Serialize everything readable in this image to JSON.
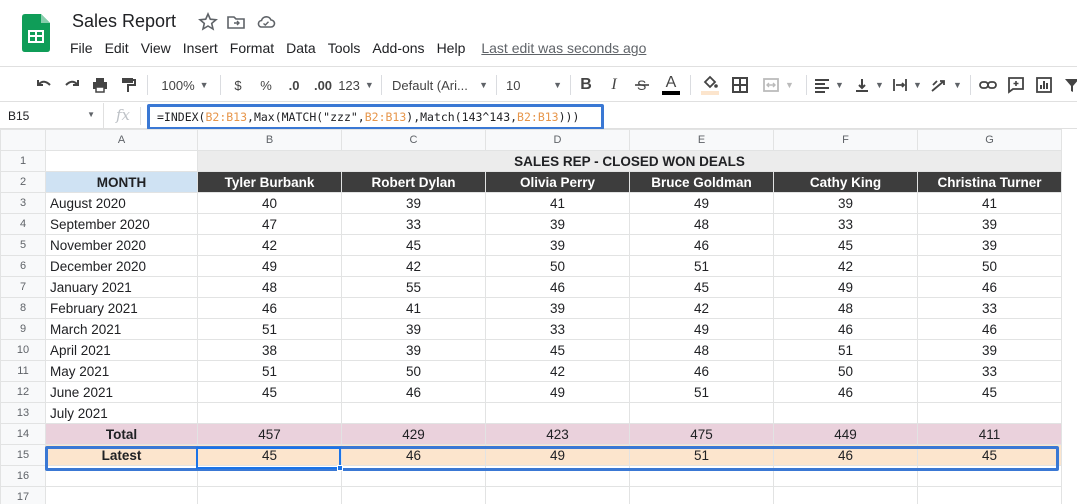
{
  "app": {
    "title": "Sales Report",
    "menu": [
      "File",
      "Edit",
      "View",
      "Insert",
      "Format",
      "Data",
      "Tools",
      "Add-ons",
      "Help"
    ],
    "last_edit": "Last edit was seconds ago"
  },
  "toolbar": {
    "zoom": "100%",
    "currency": "$",
    "percent": "%",
    "decrease_decimals": ".0",
    "increase_decimals": ".00",
    "more_formats": "123",
    "font": "Default (Ari...",
    "font_size": "10",
    "bold": "B",
    "italic": "I",
    "text_color": "A"
  },
  "formula_bar": {
    "name_box": "B15",
    "fx": "fx",
    "formula_parts": [
      {
        "text": "=INDEX(",
        "ref": false
      },
      {
        "text": "B2:B13",
        "ref": true
      },
      {
        "text": ",Max(MATCH(\"zzz\",",
        "ref": false
      },
      {
        "text": "B2:B13",
        "ref": true
      },
      {
        "text": "),Match(143^143,",
        "ref": false
      },
      {
        "text": "B2:B13",
        "ref": true
      },
      {
        "text": ")))",
        "ref": false
      }
    ]
  },
  "sheet": {
    "columns": [
      "A",
      "B",
      "C",
      "D",
      "E",
      "F",
      "G"
    ],
    "row_numbers": [
      "1",
      "2",
      "3",
      "4",
      "5",
      "6",
      "7",
      "8",
      "9",
      "10",
      "11",
      "12",
      "13",
      "14",
      "15",
      "16",
      "17"
    ],
    "banner": "SALES REP - CLOSED WON DEALS",
    "month_header": "MONTH",
    "reps": [
      "Tyler Burbank",
      "Robert Dylan",
      "Olivia Perry",
      "Bruce Goldman",
      "Cathy King",
      "Christina Turner"
    ],
    "rows": [
      {
        "month": "August 2020",
        "values": [
          "40",
          "39",
          "41",
          "49",
          "39",
          "41"
        ]
      },
      {
        "month": "September 2020",
        "values": [
          "47",
          "33",
          "39",
          "48",
          "33",
          "39"
        ]
      },
      {
        "month": "November 2020",
        "values": [
          "42",
          "45",
          "39",
          "46",
          "45",
          "39"
        ]
      },
      {
        "month": "December 2020",
        "values": [
          "49",
          "42",
          "50",
          "51",
          "42",
          "50"
        ]
      },
      {
        "month": "January 2021",
        "values": [
          "48",
          "55",
          "46",
          "45",
          "49",
          "46"
        ]
      },
      {
        "month": "February 2021",
        "values": [
          "46",
          "41",
          "39",
          "42",
          "48",
          "33"
        ]
      },
      {
        "month": "March 2021",
        "values": [
          "51",
          "39",
          "33",
          "49",
          "46",
          "46"
        ]
      },
      {
        "month": "April 2021",
        "values": [
          "38",
          "39",
          "45",
          "48",
          "51",
          "39"
        ]
      },
      {
        "month": "May 2021",
        "values": [
          "51",
          "50",
          "42",
          "46",
          "50",
          "33"
        ]
      },
      {
        "month": "June 2021",
        "values": [
          "45",
          "46",
          "49",
          "51",
          "46",
          "45"
        ]
      },
      {
        "month": "July 2021",
        "values": [
          "",
          "",
          "",
          "",
          "",
          ""
        ]
      }
    ],
    "total": {
      "label": "Total",
      "values": [
        "457",
        "429",
        "423",
        "475",
        "449",
        "411"
      ]
    },
    "latest": {
      "label": "Latest",
      "values": [
        "45",
        "46",
        "49",
        "51",
        "46",
        "45"
      ]
    }
  },
  "colors": {
    "accent": "#3a78d4",
    "rep_header_bg": "#3d3d3d",
    "month_header_bg": "#cfe2f3",
    "total_row_bg": "#ead1dc",
    "latest_row_bg": "#fce5cd"
  }
}
